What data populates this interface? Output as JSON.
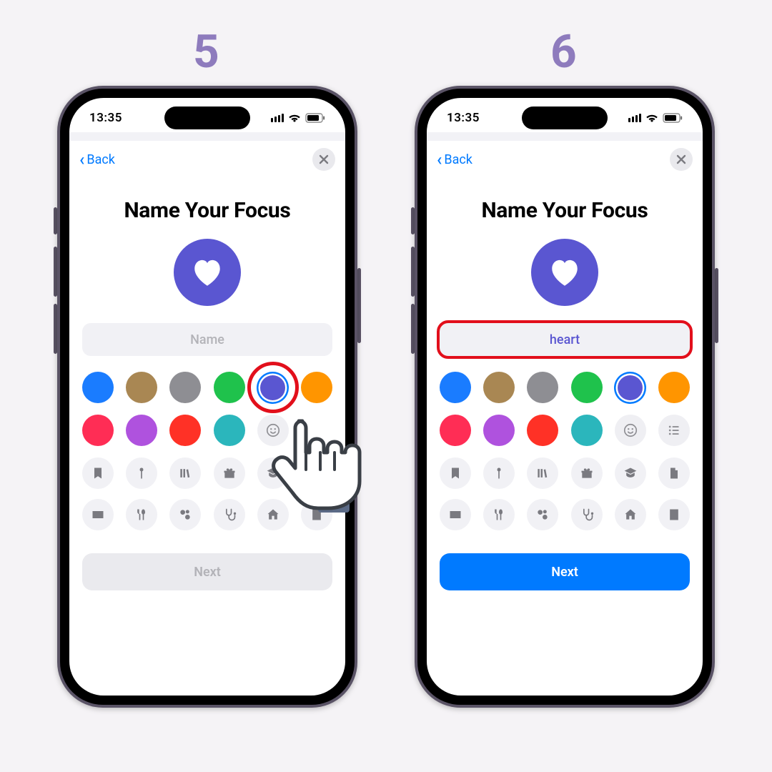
{
  "steps": [
    "5",
    "6"
  ],
  "status": {
    "time": "13:35"
  },
  "nav": {
    "back": "Back"
  },
  "title": "Name Your Focus",
  "name_placeholder": "Name",
  "name_value": "heart",
  "next_label": "Next",
  "colors_row1": [
    "#1a7cff",
    "#a98753",
    "#8e8e93",
    "#1fc24c",
    "#5a56d1",
    "#ff9500"
  ],
  "colors_row2": [
    "#ff2d55",
    "#af52de",
    "#ff3126",
    "#2bb6bc"
  ],
  "selected_color_index": 4,
  "icon_color": "#5a56d1",
  "glyph_rows": [
    [
      "bookmark",
      "pin",
      "books",
      "gift",
      "grad",
      "file"
    ],
    [
      "card",
      "fork",
      "pills",
      "steth",
      "house",
      "building"
    ]
  ]
}
